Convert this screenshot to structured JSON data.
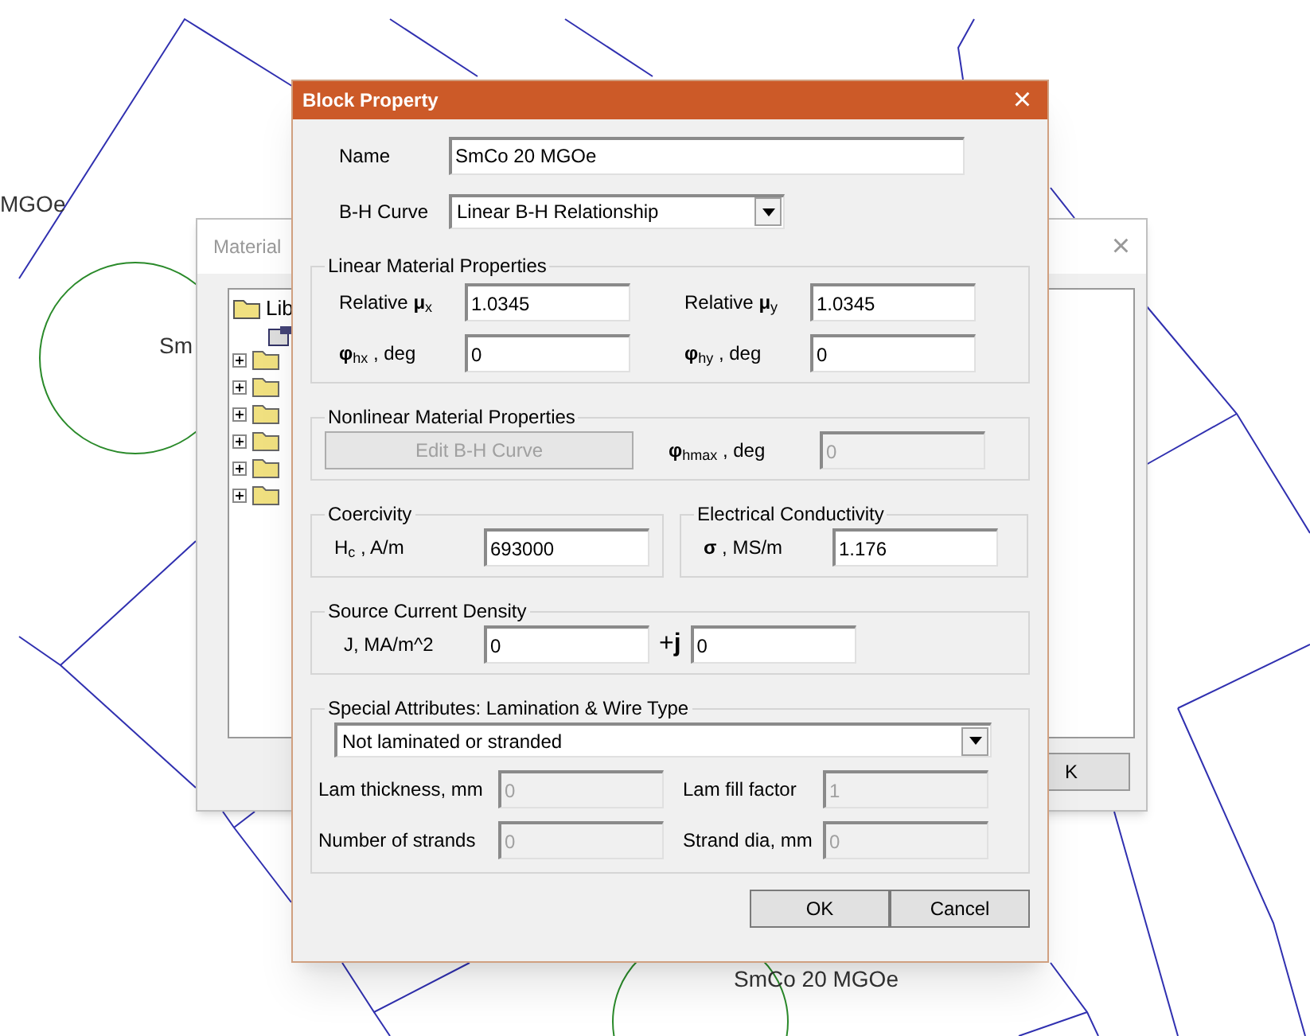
{
  "canvas": {
    "labels": [
      {
        "text": "MGOe"
      },
      {
        "text": "Sm"
      },
      {
        "text": "SmCo 20 MGOe"
      }
    ]
  },
  "background_window": {
    "title": "Material",
    "close": "×",
    "tree": {
      "root": "Lib",
      "folders": [
        {
          "expanded": false
        },
        {
          "expanded": false
        },
        {
          "expanded": false
        },
        {
          "expanded": false
        },
        {
          "expanded": false
        },
        {
          "expanded": false
        }
      ]
    },
    "button": "K"
  },
  "dialog": {
    "title": "Block Property",
    "close": "×",
    "name": {
      "label": "Name",
      "value": "SmCo 20 MGOe"
    },
    "bh_curve": {
      "label": "B-H Curve",
      "value": "Linear B-H Relationship"
    },
    "linear": {
      "title": "Linear Material Properties",
      "fields": [
        {
          "label": "Relative **μ**$_{x}$",
          "value": "1.0345",
          "disabled": false
        },
        {
          "label": "Relative **μ**$_{y}$",
          "value": "1.0345",
          "disabled": false
        },
        {
          "label": "**φ**$_{hx}$ , deg",
          "value": "0",
          "disabled": false
        },
        {
          "label": "**φ**$_{hy}$ , deg",
          "value": "0",
          "disabled": false
        }
      ]
    },
    "nonlinear": {
      "title": "Nonlinear Material Properties",
      "button": {
        "label": "Edit B-H Curve",
        "disabled": true
      },
      "field": {
        "label": "**φ**$_{hmax}$ , deg",
        "value": "0",
        "disabled": true
      }
    },
    "coercivity": {
      "title": "Coercivity",
      "label": "H$_{c}$ , A/m",
      "value": "693000",
      "disabled": false
    },
    "conductivity": {
      "title": "Electrical Conductivity",
      "label": "**σ** , MS/m",
      "value": "1.176",
      "disabled": false
    },
    "source": {
      "title": "Source Current Density",
      "label": "J, MA/m^2",
      "value": "0",
      "imag_label": "+**j**",
      "imag_value": "0",
      "disabled": false
    },
    "special": {
      "title": "Special Attributes:  Lamination & Wire Type",
      "type": "Not laminated or stranded",
      "fields": [
        {
          "label": "Lam thickness, mm",
          "value": "0",
          "disabled": true
        },
        {
          "label": "Lam fill factor",
          "value": "1",
          "disabled": true
        },
        {
          "label": "Number of strands",
          "value": "0",
          "disabled": true
        },
        {
          "label": "Strand dia, mm",
          "value": "0",
          "disabled": true
        }
      ]
    },
    "buttons": [
      "OK",
      "Cancel"
    ]
  }
}
